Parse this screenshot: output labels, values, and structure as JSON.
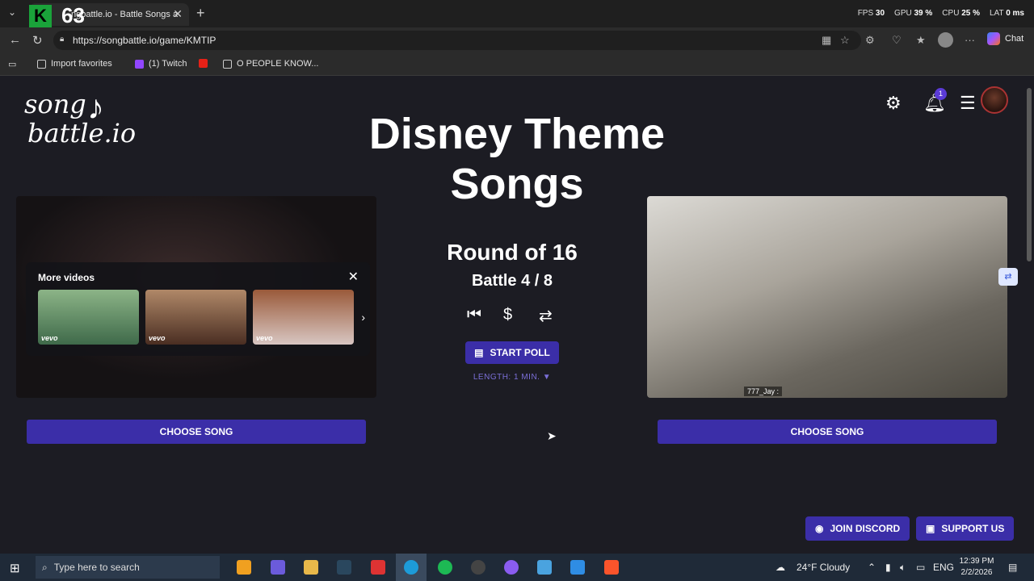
{
  "browser": {
    "tab_title": "ngbattle.io - Battle Songs a",
    "overlay_number": "63",
    "overlay_k": "K",
    "stats": [
      {
        "label": "FPS",
        "value": "30"
      },
      {
        "label": "GPU",
        "value": "39 %"
      },
      {
        "label": "CPU",
        "value": "25 %"
      },
      {
        "label": "LAT",
        "value": "0 ms"
      }
    ],
    "url": "https://songbattle.io/game/KMTIP",
    "chat_label": "Chat",
    "favorites": [
      "Import favorites",
      "(1) Twitch",
      "",
      "O PEOPLE KNOW..."
    ]
  },
  "page": {
    "logo_line1": "song",
    "logo_line2": "battle.io",
    "title": "Disney Theme Songs",
    "notification_count": "1",
    "round": "Round of 16",
    "battle": "Battle 4 / 8",
    "start_poll_label": "START POLL",
    "length_label": "LENGTH: 1 MIN. ▼",
    "choose_song_left": "CHOOSE SONG",
    "choose_song_right": "CHOOSE SONG",
    "join_discord": "JOIN DISCORD",
    "support_us": "SUPPORT US",
    "more_videos_title": "More videos",
    "thumb_brand": "vevo",
    "video_tag": "777_Jay :"
  },
  "taskbar": {
    "search_placeholder": "Type here to search",
    "weather": "24°F  Cloudy",
    "lang": "ENG",
    "time": "12:39 PM",
    "date": "2/2/2026"
  },
  "colors": {
    "accent": "#3b2ea8",
    "page_bg": "#1c1c23",
    "length_text": "#7b6fd8"
  }
}
